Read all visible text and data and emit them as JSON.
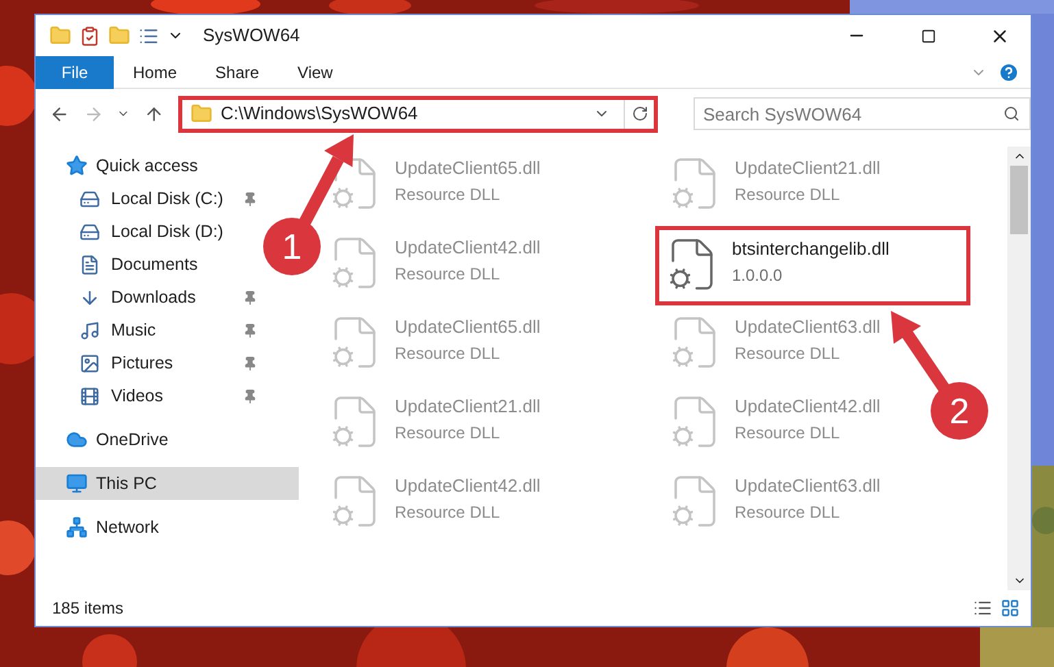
{
  "window": {
    "title": "SysWOW64"
  },
  "ribbon_tabs": [
    {
      "label": "File",
      "kind": "menu"
    },
    {
      "label": "Home",
      "kind": "tab"
    },
    {
      "label": "Share",
      "kind": "tab"
    },
    {
      "label": "View",
      "kind": "tab"
    }
  ],
  "address": {
    "path": "C:\\Windows\\SysWOW64",
    "highlighted": true
  },
  "search": {
    "placeholder": "Search SysWOW64"
  },
  "sidebar": {
    "items": [
      {
        "label": "Quick access",
        "selected": false,
        "children": [
          {
            "label": "Local Disk (C:)",
            "pinned": true,
            "selected": false
          },
          {
            "label": "Local Disk (D:)",
            "pinned": false,
            "selected": false
          },
          {
            "label": "Documents",
            "pinned": false,
            "selected": false
          },
          {
            "label": "Downloads",
            "pinned": true,
            "selected": false
          },
          {
            "label": "Music",
            "pinned": true,
            "selected": false
          },
          {
            "label": "Pictures",
            "pinned": true,
            "selected": false
          },
          {
            "label": "Videos",
            "pinned": true,
            "selected": false
          }
        ]
      },
      {
        "label": "OneDrive",
        "selected": false
      },
      {
        "label": "This PC",
        "selected": true
      },
      {
        "label": "Network",
        "selected": false
      }
    ]
  },
  "files": [
    {
      "name": "UpdateClient65.dll",
      "detail": "Resource DLL",
      "dimmed": true,
      "highlighted": false
    },
    {
      "name": "UpdateClient21.dll",
      "detail": "Resource DLL",
      "dimmed": true,
      "highlighted": false
    },
    {
      "name": "UpdateClient42.dll",
      "detail": "Resource DLL",
      "dimmed": true,
      "highlighted": false
    },
    {
      "name": "btsinterchangelib.dll",
      "detail": "1.0.0.0",
      "dimmed": false,
      "highlighted": true
    },
    {
      "name": "UpdateClient65.dll",
      "detail": "Resource DLL",
      "dimmed": true,
      "highlighted": false
    },
    {
      "name": "UpdateClient63.dll",
      "detail": "Resource DLL",
      "dimmed": true,
      "highlighted": false
    },
    {
      "name": "UpdateClient21.dll",
      "detail": "Resource DLL",
      "dimmed": true,
      "highlighted": false
    },
    {
      "name": "UpdateClient42.dll",
      "detail": "Resource DLL",
      "dimmed": true,
      "highlighted": false
    },
    {
      "name": "UpdateClient42.dll",
      "detail": "Resource DLL",
      "dimmed": true,
      "highlighted": false
    },
    {
      "name": "UpdateClient63.dll",
      "detail": "Resource DLL",
      "dimmed": true,
      "highlighted": false
    }
  ],
  "status_bar": {
    "count": "185 items"
  },
  "annotations": [
    {
      "label": "1"
    },
    {
      "label": "2"
    }
  ]
}
